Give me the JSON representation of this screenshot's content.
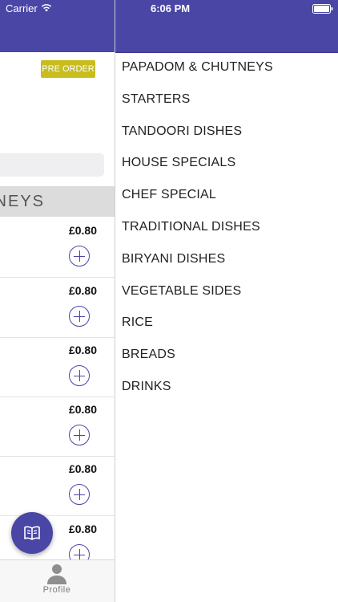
{
  "status_bar": {
    "carrier": "Carrier",
    "time": "6:06 PM",
    "wifi_icon": "wifi-icon",
    "battery_icon": "battery-icon"
  },
  "colors": {
    "primary": "#4a46a6",
    "preorder_badge": "#c8bd1d",
    "category_header_bg": "#dcdcdc"
  },
  "left_screen": {
    "preorder_label": "PRE ORDER",
    "category_header": "NEYS",
    "items": [
      {
        "price": "£0.80",
        "add_icon": "plus-circle-icon"
      },
      {
        "price": "£0.80",
        "add_icon": "plus-circle-icon"
      },
      {
        "price": "£0.80",
        "add_icon": "plus-circle-icon"
      },
      {
        "price": "£0.80",
        "add_icon": "plus-circle-icon"
      },
      {
        "price": "£0.80",
        "add_icon": "plus-circle-icon"
      },
      {
        "price": "£0.80",
        "add_icon": "plus-circle-icon"
      }
    ],
    "fab_icon": "menu-book-icon",
    "tabbar": {
      "profile_label": "Profile",
      "profile_icon": "profile-icon"
    }
  },
  "side_menu": {
    "items": [
      "PAPADOM & CHUTNEYS",
      "STARTERS",
      "TANDOORI DISHES",
      "HOUSE SPECIALS",
      "CHEF SPECIAL",
      "TRADITIONAL DISHES",
      "BIRYANI DISHES",
      "VEGETABLE SIDES",
      "RICE",
      "BREADS",
      "DRINKS"
    ]
  }
}
